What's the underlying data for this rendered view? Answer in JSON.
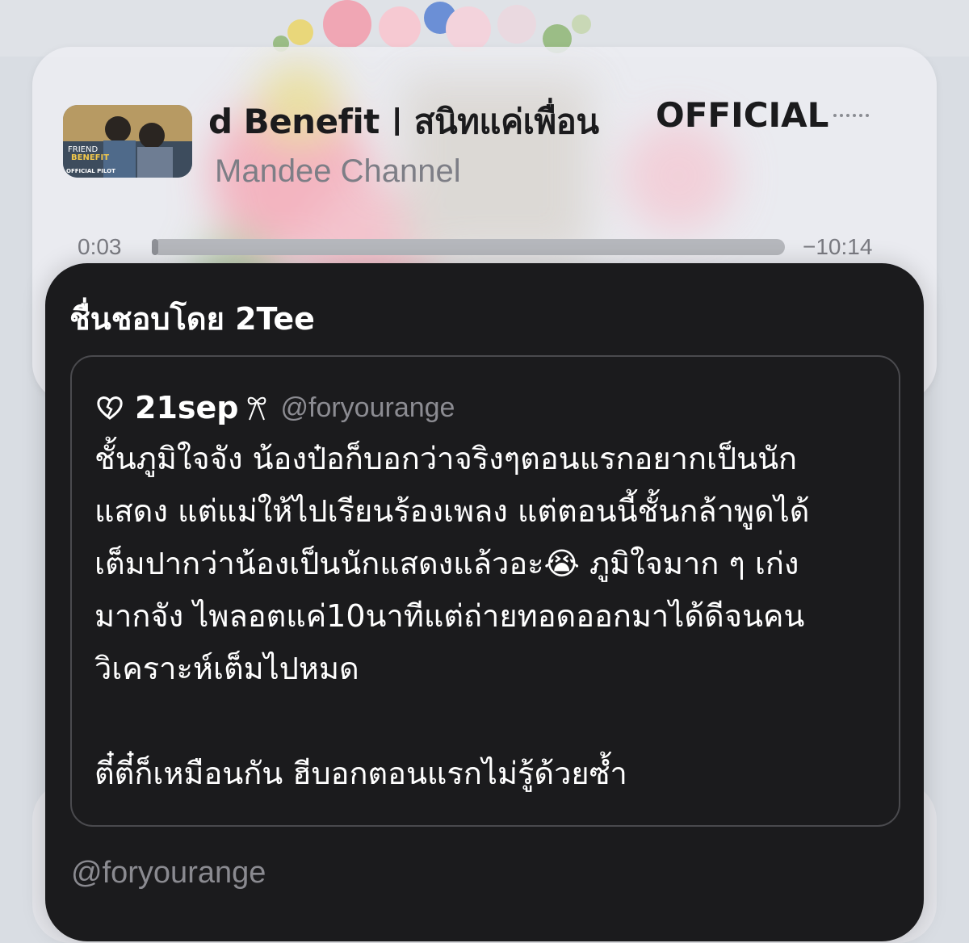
{
  "player": {
    "title": "d Benefit | สนิทแค่เพื่อน",
    "title_suffix": "OFFICIAL",
    "channel": "Mandee Channel",
    "elapsed": "0:03",
    "remaining": "−10:14",
    "progress_fraction": 0.005
  },
  "thumbnail": {
    "line1": "FRIEND",
    "line2": "BENEFIT",
    "line3": "OFFICIAL PILOT"
  },
  "card": {
    "liked_by": "ชื่นชอบโดย 2Tee",
    "author_name": "21sep",
    "author_handle": "@foryourange",
    "body_lines": [
      "ชั้นภูมิใจจัง น้องป๋อก็บอกว่าจริงๆตอนแรกอยากเป็นนัก",
      "แสดง แต่แม่ให้ไปเรียนร้องเพลง แต่ตอนนี้ชั้นกล้าพูดได้",
      "เต็มปากว่าน้องเป็นนักแสดงแล้วอะ😭 ภูมิใจมาก ๆ เก่ง",
      "มากจัง ไพลอตแค่10นาทีแต่ถ่ายทอดออกมาได้ดีจนคน",
      "วิเคราะห์เต็มไปหมด"
    ],
    "body_last": "ตี๋ตี๋ก็เหมือนกัน ฮีบอกตอนแรกไม่รู้ด้วยซ้ำ",
    "footer_handle": "@foryourange"
  },
  "icons": [
    "heart-icon",
    "bow-icon",
    "more-icon"
  ],
  "colors": {
    "card_dark": "#1b1b1d",
    "border": "#4a4a4e",
    "muted": "#8a8a90"
  }
}
